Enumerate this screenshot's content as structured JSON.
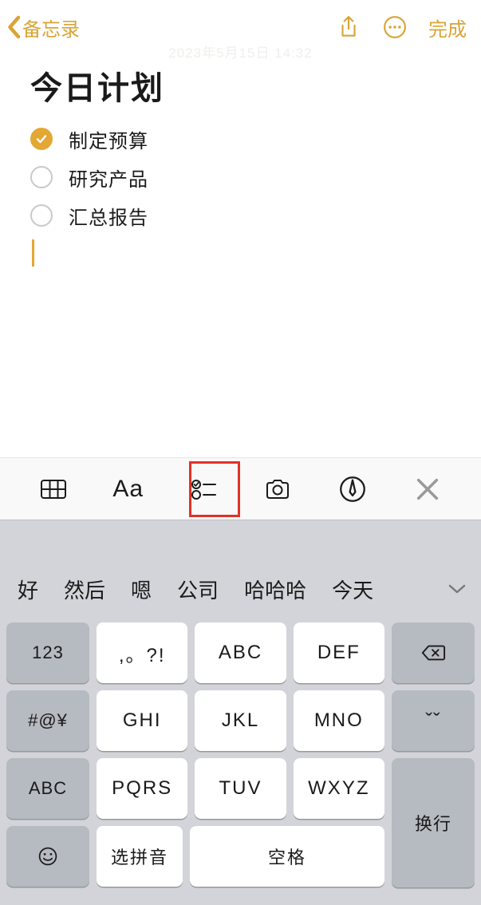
{
  "nav": {
    "back_label": "备忘录",
    "done_label": "完成"
  },
  "faded_timestamp": "2023年5月15日 14:32",
  "note": {
    "title": "今日计划",
    "items": [
      {
        "label": "制定预算",
        "checked": true
      },
      {
        "label": "研究产品",
        "checked": false
      },
      {
        "label": "汇总报告",
        "checked": false
      }
    ]
  },
  "format_bar": {
    "table_icon": "table-icon",
    "aa_label": "Aa",
    "checklist_icon": "checklist-icon",
    "camera_icon": "camera-icon",
    "pen_icon": "markup-icon",
    "close_icon": "close-icon",
    "highlight_index": 2
  },
  "keyboard": {
    "suggestions": [
      "好",
      "然后",
      "嗯",
      "公司",
      "哈哈哈",
      "今天"
    ],
    "side_left": [
      "123",
      "#@¥",
      "ABC"
    ],
    "rows": [
      [
        ",。?!",
        "ABC",
        "DEF"
      ],
      [
        "GHI",
        "JKL",
        "MNO"
      ],
      [
        "PQRS",
        "TUV",
        "WXYZ"
      ]
    ],
    "bottom_left_emoji": "emoji",
    "select_pinyin": "选拼音",
    "space": "空格",
    "delete_icon": "delete",
    "carat": "ˇˇ",
    "enter": "换行"
  }
}
